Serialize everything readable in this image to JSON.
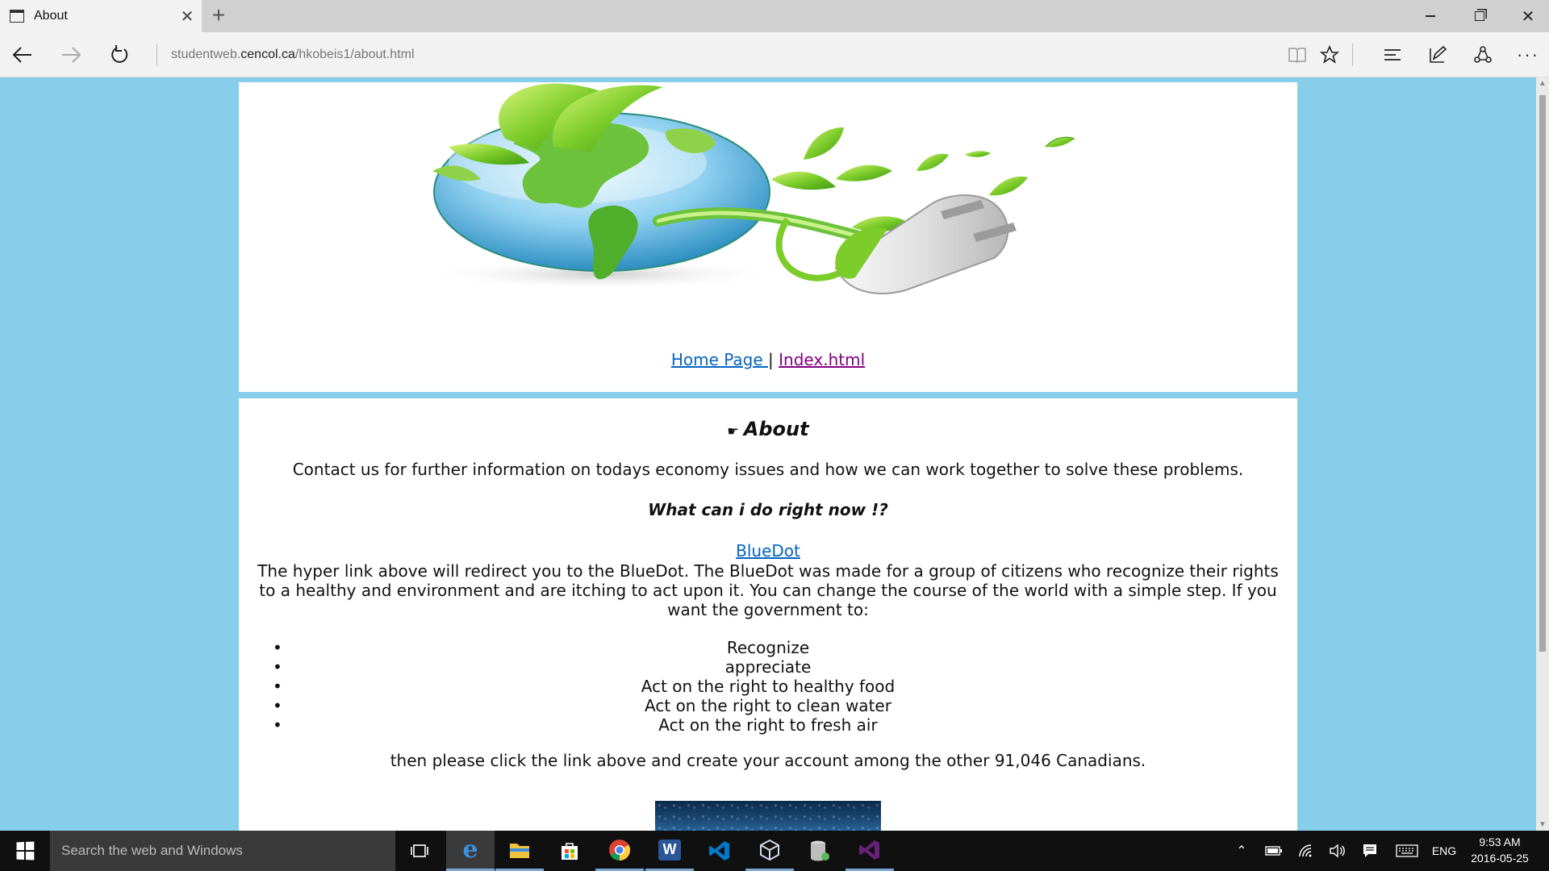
{
  "browser": {
    "tab_title": "About",
    "tab_close": "✕",
    "new_tab": "+",
    "address_scheme_prefix": "studentweb.",
    "address_host": "cencol.ca",
    "address_path": "/hkobeis1/about.html",
    "icons": [
      "tab-page-icon",
      "back-arrow-icon",
      "forward-arrow-icon",
      "refresh-icon",
      "reading-view-icon",
      "favorite-star-icon",
      "hub-icon",
      "web-note-icon",
      "share-icon",
      "more-icon",
      "minimize-icon",
      "maximize-icon",
      "close-icon"
    ]
  },
  "header": {
    "nav_link_home": "Home Page ",
    "nav_separator": "|",
    "nav_link_index": "Index.html"
  },
  "content": {
    "heading_icon": "☛",
    "heading": "About",
    "contact_text": "Contact us for further information on todays economy issues and how we can work together to solve these problems.",
    "question": "What can i do right now !?",
    "bluedot_link": "BlueDot",
    "paragraph": "The hyper link above will redirect you to the BlueDot. The BlueDot was made for a group of citizens who recognize their rights to a healthy and environment and are itching to act upon it. You can change the course of the world with a simple step. If you want the government to:",
    "rights": [
      "Recognize",
      "appreciate",
      "Act on the right to healthy food",
      "Act on the right to clean water",
      "Act on the right to fresh air"
    ],
    "bullet": "•",
    "closing": "then please click the link above and create your account among the other 91,046 Canadians."
  },
  "taskbar": {
    "search_placeholder": "Search the web and Windows",
    "edge_letter": "e",
    "word_letter": "W",
    "language": "ENG",
    "time": "9:53 AM",
    "date": "2016-05-25",
    "colors": {
      "accent": "#7aa7d8",
      "edge": "#1e90ff",
      "word": "#2b579a",
      "vs": "#68217a",
      "vscode": "#0079cc"
    }
  },
  "page": {
    "background": "#87ceeb",
    "link_color": "#0563c1",
    "visited_link_color": "#800080"
  }
}
